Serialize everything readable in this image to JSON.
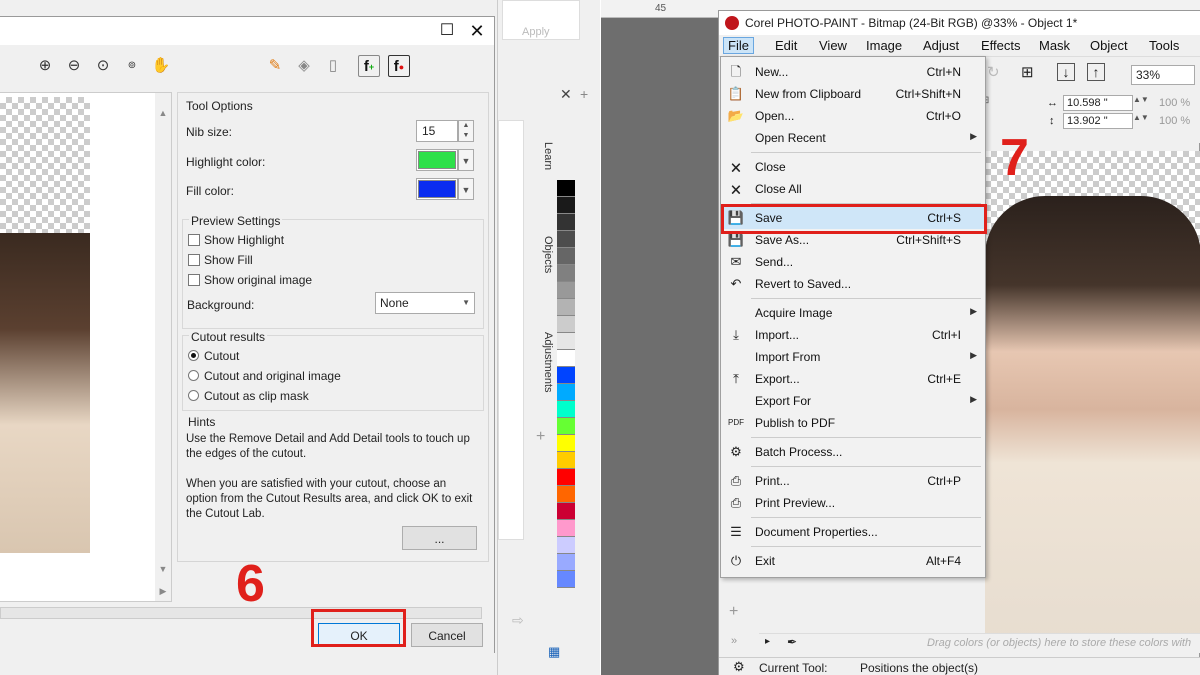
{
  "cutout_dialog": {
    "toolbar_icons": [
      "zoom-in-icon",
      "zoom-out-icon",
      "zoom-fit-icon",
      "zoom-100-icon",
      "pan-hand-icon",
      "highlight-marker-icon",
      "fill-bucket-icon",
      "eraser-icon",
      "add-detail-icon",
      "remove-detail-icon"
    ],
    "tool_options": {
      "title": "Tool Options",
      "nib_size_label": "Nib size:",
      "nib_size_value": "15",
      "highlight_color_label": "Highlight color:",
      "highlight_color": "#2ee04a",
      "fill_color_label": "Fill color:",
      "fill_color": "#0a2cf0"
    },
    "preview_settings": {
      "title": "Preview Settings",
      "show_highlight": "Show Highlight",
      "show_fill": "Show Fill",
      "show_original": "Show original image",
      "background_label": "Background:",
      "background_value": "None"
    },
    "cutout_results": {
      "title": "Cutout results",
      "options": [
        "Cutout",
        "Cutout and original image",
        "Cutout as clip mask"
      ],
      "selected": "Cutout"
    },
    "hints": {
      "title": "Hints",
      "text1": "Use the Remove Detail and Add Detail tools to touch up the edges of the cutout.",
      "text2": "When you are satisfied with your cutout, choose an option from the Cutout Results area, and click OK to exit the Cutout Lab.",
      "more_button": "..."
    },
    "ok_button": "OK",
    "cancel_button": "Cancel",
    "step_number": "6"
  },
  "docker": {
    "tabs": [
      "Learn",
      "Objects",
      "Adjustments"
    ],
    "apply_label": "Apply"
  },
  "palette_colors": [
    "#000000",
    "#1a1a1a",
    "#333333",
    "#4d4d4d",
    "#666666",
    "#808080",
    "#999999",
    "#b3b3b3",
    "#cccccc",
    "#e6e6e6",
    "#ffffff",
    "#0044ff",
    "#00aaff",
    "#00ffcc",
    "#66ff33",
    "#ffff00",
    "#ffcc00",
    "#ff0000",
    "#ff6600",
    "#cc0033",
    "#ff99cc",
    "#ccccff",
    "#99aaff",
    "#6688ff"
  ],
  "corel": {
    "title": "Corel PHOTO-PAINT - Bitmap (24-Bit RGB) @33% - Object 1*",
    "menu": [
      "File",
      "Edit",
      "View",
      "Image",
      "Adjust",
      "Effects",
      "Mask",
      "Object",
      "Tools"
    ],
    "ruler_mark": "45",
    "zoom": "33%",
    "width_value": "10.598 \"",
    "height_value": "13.902 \"",
    "width_pct": "100 %",
    "height_pct": "100 %",
    "step_number": "7",
    "status_tool_label": "Current Tool:",
    "status_tool_value": "Positions the object(s)",
    "palette_hint": "Drag colors (or objects) here to store these colors with"
  },
  "file_menu": [
    {
      "label": "New...",
      "shortcut": "Ctrl+N",
      "icon": "new-document-icon",
      "sub": false
    },
    {
      "label": "New from Clipboard",
      "shortcut": "Ctrl+Shift+N",
      "icon": "paste-new-icon",
      "sub": false
    },
    {
      "label": "Open...",
      "shortcut": "Ctrl+O",
      "icon": "open-folder-icon",
      "sub": false
    },
    {
      "label": "Open Recent",
      "shortcut": "",
      "icon": "",
      "sub": true
    },
    {
      "label": "Close",
      "shortcut": "",
      "icon": "close-document-icon",
      "sub": false
    },
    {
      "label": "Close All",
      "shortcut": "",
      "icon": "close-all-icon",
      "sub": false
    },
    {
      "label": "Save",
      "shortcut": "Ctrl+S",
      "icon": "save-icon",
      "sub": false
    },
    {
      "label": "Save As...",
      "shortcut": "Ctrl+Shift+S",
      "icon": "save-as-icon",
      "sub": false
    },
    {
      "label": "Send...",
      "shortcut": "",
      "icon": "send-mail-icon",
      "sub": false
    },
    {
      "label": "Revert to Saved...",
      "shortcut": "",
      "icon": "revert-icon",
      "sub": false
    },
    {
      "label": "Acquire Image",
      "shortcut": "",
      "icon": "",
      "sub": true
    },
    {
      "label": "Import...",
      "shortcut": "Ctrl+I",
      "icon": "import-icon",
      "sub": false
    },
    {
      "label": "Import From",
      "shortcut": "",
      "icon": "",
      "sub": true
    },
    {
      "label": "Export...",
      "shortcut": "Ctrl+E",
      "icon": "export-icon",
      "sub": false
    },
    {
      "label": "Export For",
      "shortcut": "",
      "icon": "",
      "sub": true
    },
    {
      "label": "Publish to PDF",
      "shortcut": "",
      "icon": "pdf-icon",
      "sub": false
    },
    {
      "label": "Batch Process...",
      "shortcut": "",
      "icon": "batch-icon",
      "sub": false
    },
    {
      "label": "Print...",
      "shortcut": "Ctrl+P",
      "icon": "print-icon",
      "sub": false
    },
    {
      "label": "Print Preview...",
      "shortcut": "",
      "icon": "print-preview-icon",
      "sub": false
    },
    {
      "label": "Document Properties...",
      "shortcut": "",
      "icon": "document-properties-icon",
      "sub": false
    },
    {
      "label": "Exit",
      "shortcut": "Alt+F4",
      "icon": "exit-power-icon",
      "sub": false
    }
  ]
}
